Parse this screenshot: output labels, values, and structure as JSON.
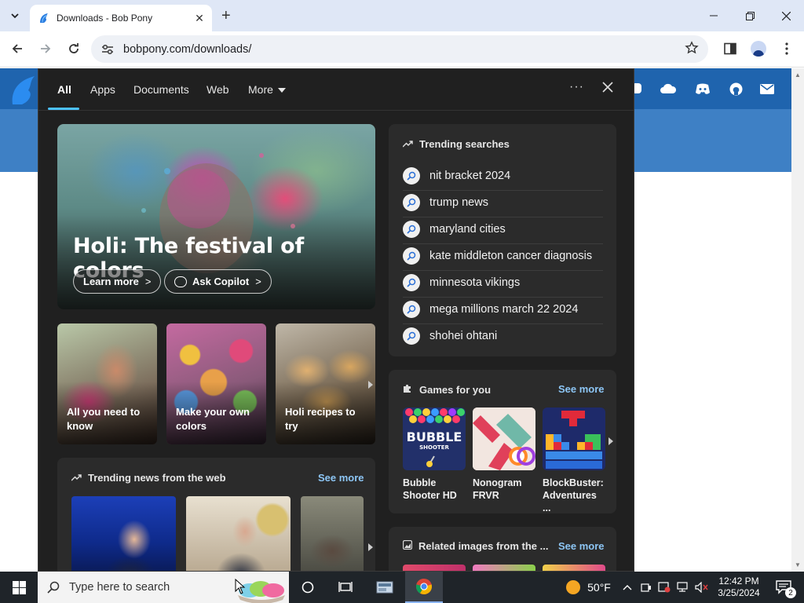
{
  "browser": {
    "tab_title": "Downloads - Bob Pony",
    "new_tab_symbol": "+",
    "url": "bobpony.com/downloads/"
  },
  "flyout": {
    "tabs": [
      "All",
      "Apps",
      "Documents",
      "Web",
      "More"
    ],
    "more_menu_symbol": "···",
    "hero": {
      "title": "Holi: The festival of colors",
      "learn_more": "Learn more",
      "ask_copilot": "Ask Copilot"
    },
    "mini_cards": [
      {
        "label": "All you need to know"
      },
      {
        "label": "Make your own colors"
      },
      {
        "label": "Holi recipes to try"
      }
    ],
    "trending_news": {
      "heading": "Trending news from the web",
      "see_more": "See more"
    },
    "trending_searches": {
      "heading": "Trending searches",
      "items": [
        "nit bracket 2024",
        "trump news",
        "maryland cities",
        "kate middleton cancer diagnosis",
        "minnesota vikings",
        "mega millions march 22 2024",
        "shohei ohtani"
      ]
    },
    "games": {
      "heading": "Games for you",
      "see_more": "See more",
      "items": [
        {
          "name": "Bubble Shooter HD",
          "logo_text": "BUBBLE",
          "logo_sub": "SHOOTER"
        },
        {
          "name": "Nonogram FRVR"
        },
        {
          "name": "BlockBuster: Adventures ..."
        }
      ]
    },
    "related_images": {
      "heading": "Related images from the ...",
      "see_more": "See more"
    }
  },
  "taskbar": {
    "search_placeholder": "Type here to search",
    "weather": "50°F",
    "time": "12:42 PM",
    "date": "3/25/2024",
    "notification_count": "2"
  },
  "colors": {
    "flyout_bg": "#202020",
    "card_bg": "#2b2b2b",
    "accent": "#4cc2ff",
    "link": "#8dc6f5",
    "site_blue": "#3e80c5"
  }
}
